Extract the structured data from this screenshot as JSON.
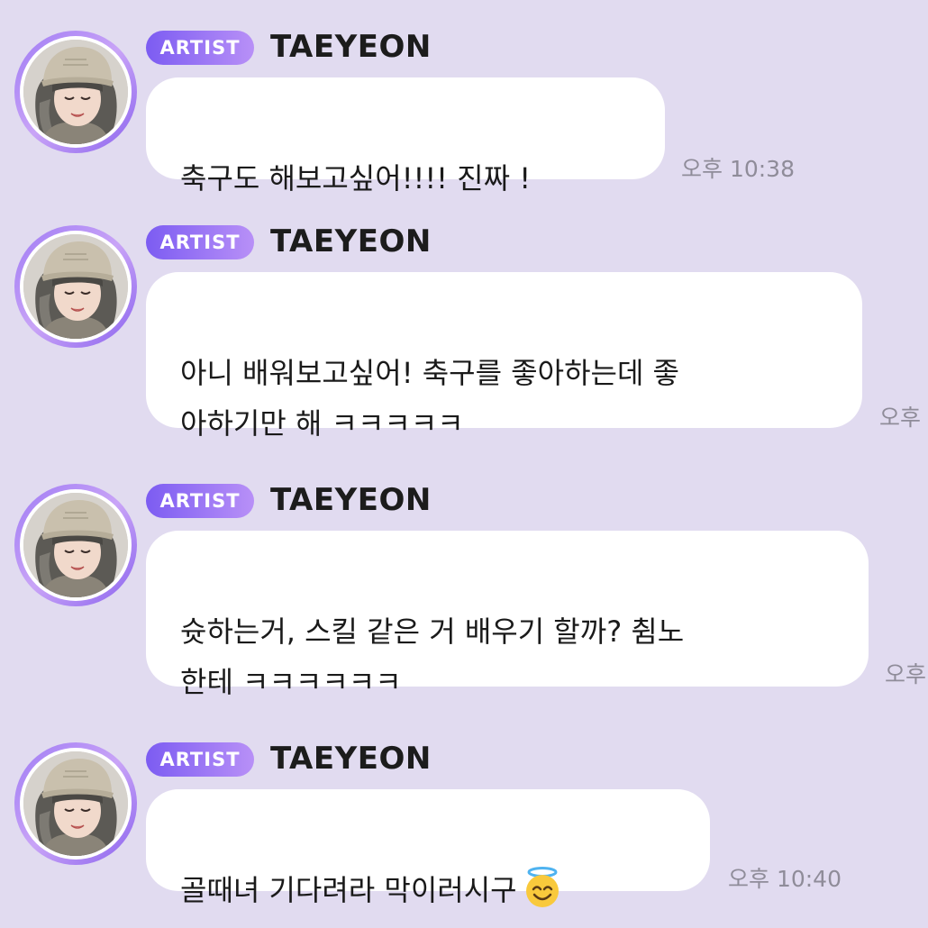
{
  "colors": {
    "background": "#e1dbf0",
    "bubble": "#ffffff",
    "badge_start": "#7c5cf2",
    "badge_end": "#b890f7",
    "timestamp": "#8f8c99"
  },
  "messages": [
    {
      "badge": "ARTIST",
      "sender": "TAEYEON",
      "avatar_icon": "taeyeon-avatar",
      "text": "축구도 해보고싶어!!!! 진짜 !",
      "timestamp": "오후 10:38"
    },
    {
      "badge": "ARTIST",
      "sender": "TAEYEON",
      "avatar_icon": "taeyeon-avatar",
      "text": "아니 배워보고싶어! 축구를 좋아하는데 좋\n아하기만 해 ㅋㅋㅋㅋㅋ",
      "timestamp": "오후"
    },
    {
      "badge": "ARTIST",
      "sender": "TAEYEON",
      "avatar_icon": "taeyeon-avatar",
      "text": "슛하는거, 스킬 같은 거 배우기 할까? 췸노\n한테 ㅋㅋㅋㅋㅋㅋ",
      "timestamp": "오후"
    },
    {
      "badge": "ARTIST",
      "sender": "TAEYEON",
      "avatar_icon": "taeyeon-avatar",
      "text": "골때녀 기다려라 막이러시구",
      "emoji": "smiling-face-with-halo-emoji",
      "timestamp": "오후 10:40"
    }
  ]
}
